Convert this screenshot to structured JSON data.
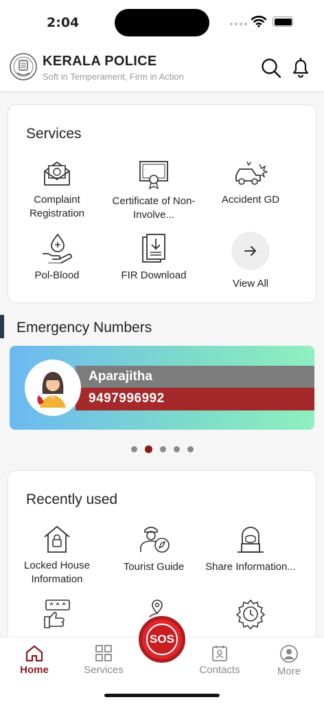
{
  "status_bar": {
    "time": "2:04"
  },
  "header": {
    "title": "KERALA POLICE",
    "subtitle": "Soft in Temperament, Firm in Action"
  },
  "services": {
    "title": "Services",
    "items": [
      {
        "label": "Complaint Registration",
        "icon": "complaint-envelope-icon"
      },
      {
        "label": "Certificate of Non-Involve...",
        "icon": "certificate-icon"
      },
      {
        "label": "Accident GD",
        "icon": "car-accident-icon"
      },
      {
        "label": "Pol-Blood",
        "icon": "blood-donation-icon"
      },
      {
        "label": "FIR Download",
        "icon": "document-download-icon"
      },
      {
        "label": "View All",
        "icon": "arrow-right-icon"
      }
    ]
  },
  "emergency": {
    "title": "Emergency Numbers",
    "banner": {
      "name": "Aparajitha",
      "number": "9497996992"
    },
    "carousel": {
      "count": 5,
      "active": 1
    }
  },
  "recent": {
    "title": "Recently used",
    "items": [
      {
        "label": "Locked House Information",
        "icon": "locked-house-icon"
      },
      {
        "label": "Tourist Guide",
        "icon": "tourist-guide-icon"
      },
      {
        "label": "Share Information...",
        "icon": "hacker-laptop-icon"
      },
      {
        "label": "",
        "icon": "rating-thumbs-up-icon"
      },
      {
        "label": "",
        "icon": "location-route-icon"
      },
      {
        "label": "",
        "icon": "gear-clock-icon"
      }
    ]
  },
  "tabbar": {
    "tabs": [
      {
        "label": "Home",
        "active": true
      },
      {
        "label": "Services"
      },
      {
        "label": "Contacts"
      },
      {
        "label": "More"
      }
    ],
    "sos": "SOS"
  },
  "colors": {
    "accent": "#8b1a1c",
    "sos": "#e0262b",
    "banner_number_bg": "#a5282a",
    "banner_name_bg": "#7c7c7c"
  }
}
